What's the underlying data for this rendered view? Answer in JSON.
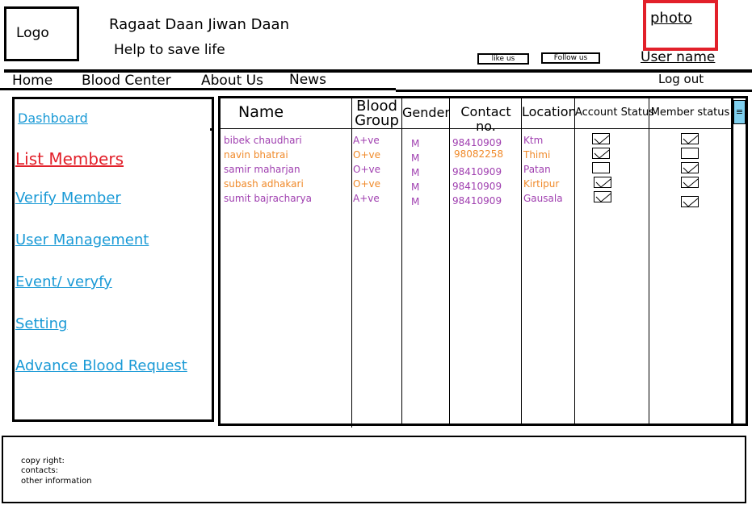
{
  "header": {
    "logo": "Logo",
    "title": "Ragaat Daan Jiwan Daan",
    "tagline": "Help to save life",
    "photo": "photo",
    "like_us": "like us",
    "follow_us": "Follow us",
    "username": "User name",
    "logout": "Log out"
  },
  "nav": {
    "items": [
      "Home",
      "Blood Center",
      "About Us",
      "News"
    ]
  },
  "sidebar": {
    "items": [
      {
        "label": "Dashboard"
      },
      {
        "label": "List Members"
      },
      {
        "label": "Verify Member"
      },
      {
        "label": "User Management"
      },
      {
        "label": "Event/ veryfy"
      },
      {
        "label": "Setting"
      },
      {
        "label": "Advance Blood Request"
      }
    ],
    "active": "List Members"
  },
  "table": {
    "headers": {
      "name": "Name",
      "blood1": "Blood",
      "blood2": "Group",
      "gender": "Gender",
      "contact": "Contact no.",
      "location": "Location",
      "account": "Account Status",
      "member": "Member status"
    },
    "rows": [
      {
        "name": "bibek chaudhari",
        "blood": "A+ve",
        "gender": "M",
        "contact": "98410909",
        "location": "Ktm",
        "account_checked": true,
        "member_checked": true
      },
      {
        "name": "navin bhatrai",
        "blood": "O+ve",
        "gender": "M",
        "contact": "98082258",
        "location": "Thimi",
        "account_checked": true,
        "member_checked": false
      },
      {
        "name": "samir maharjan",
        "blood": "O+ve",
        "gender": "M",
        "contact": "98410909",
        "location": "Patan",
        "account_checked": false,
        "member_checked": true
      },
      {
        "name": "subash adhakari",
        "blood": "O+ve",
        "gender": "M",
        "contact": "98410909",
        "location": "Kirtipur",
        "account_checked": true,
        "member_checked": true
      },
      {
        "name": "sumit bajracharya",
        "blood": "A+ve",
        "gender": "M",
        "contact": "98410909",
        "location": "Gausala",
        "account_checked": true,
        "member_checked": true
      }
    ],
    "row_colors": [
      "#a040b0",
      "#f08a2a",
      "#a040b0",
      "#f08a2a",
      "#a040b0"
    ]
  },
  "footer": {
    "lines": [
      "copy right:",
      "contacts:",
      "other information"
    ]
  },
  "colors": {
    "link": "#1a9ad6",
    "active": "#e2202a",
    "purple": "#a040b0",
    "orange": "#f08a2a",
    "scroll_thumb": "#7fd0ef"
  }
}
